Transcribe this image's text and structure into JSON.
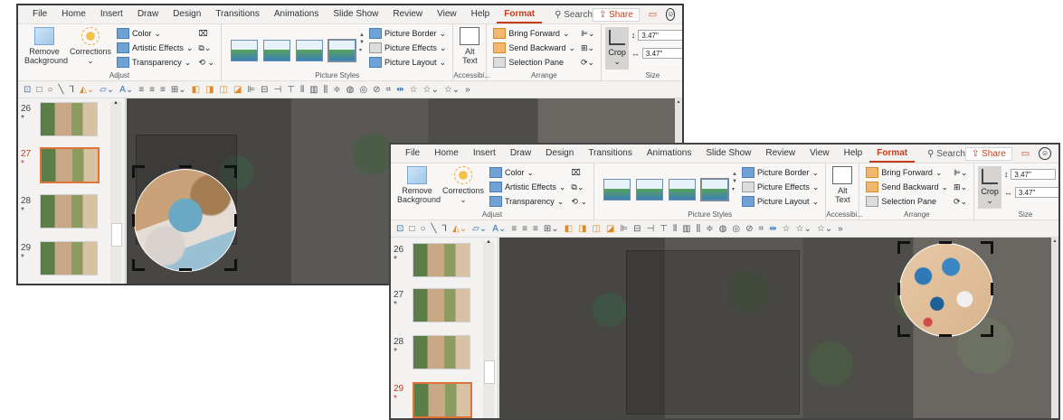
{
  "menu": {
    "tabs": [
      "File",
      "Home",
      "Insert",
      "Draw",
      "Design",
      "Transitions",
      "Animations",
      "Slide Show",
      "Review",
      "View",
      "Help"
    ],
    "active_tab": "Format",
    "search": "Search",
    "share": "Share"
  },
  "ribbon": {
    "remove_background": "Remove Background",
    "corrections": "Corrections",
    "color": "Color",
    "artistic_effects": "Artistic Effects",
    "transparency": "Transparency",
    "adjust_label": "Adjust",
    "picture_border": "Picture Border",
    "picture_effects": "Picture Effects",
    "picture_layout": "Picture Layout",
    "picture_styles_label": "Picture Styles",
    "alt_text": "Alt Text",
    "accessibility_label": "Accessibi...",
    "bring_forward": "Bring Forward",
    "send_backward": "Send Backward",
    "selection_pane": "Selection Pane",
    "arrange_label": "Arrange",
    "crop": "Crop",
    "height": "3.47\"",
    "width": "3.47\"",
    "size_label": "Size"
  },
  "slides_win1": [
    {
      "num": "26",
      "current": false
    },
    {
      "num": "27",
      "current": true
    },
    {
      "num": "28",
      "current": false
    },
    {
      "num": "29",
      "current": false
    }
  ],
  "slides_win2": [
    {
      "num": "26",
      "current": false
    },
    {
      "num": "27",
      "current": false
    },
    {
      "num": "28",
      "current": false
    },
    {
      "num": "29",
      "current": true
    }
  ],
  "slide_star": "*"
}
